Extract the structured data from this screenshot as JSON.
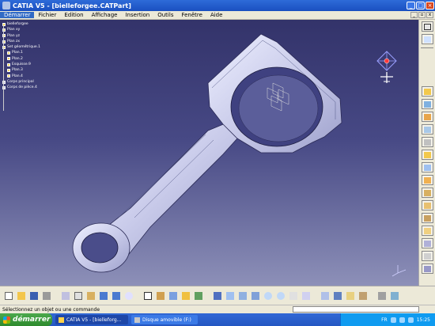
{
  "window": {
    "title": "CATIA V5 - [bielleforgee.CATPart]",
    "controls": [
      "_",
      "□",
      "×"
    ]
  },
  "menu": {
    "items": [
      "Démarrer",
      "Fichier",
      "Edition",
      "Affichage",
      "Insertion",
      "Outils",
      "Fenêtre",
      "Aide"
    ],
    "active": "Démarrer"
  },
  "tree": {
    "items": [
      {
        "label": "bielleforgee",
        "icon": "part-icon"
      },
      {
        "label": "Plan xy",
        "icon": "plane-icon"
      },
      {
        "label": "Plan yz",
        "icon": "plane-icon"
      },
      {
        "label": "Plan zx",
        "icon": "plane-icon"
      },
      {
        "label": "Set géométrique.1",
        "icon": "geometric-set-icon"
      },
      {
        "label": "Plan.1",
        "icon": "plane-icon"
      },
      {
        "label": "Plan.2",
        "icon": "plane-icon"
      },
      {
        "label": "Esquisse.9",
        "icon": "sketch-icon"
      },
      {
        "label": "Plan.3",
        "icon": "plane-icon"
      },
      {
        "label": "Plan.4",
        "icon": "plane-icon"
      },
      {
        "label": "Corps principal",
        "icon": "body-icon"
      },
      {
        "label": "Corps de pièce.4",
        "icon": "body-icon"
      }
    ]
  },
  "status": {
    "prompt": "Sélectionnez un objet ou une commande"
  },
  "taskbar": {
    "start_label": "démarrer",
    "tasks": [
      {
        "label": "CATIA V5 - [bielleforg...",
        "active": true
      },
      {
        "label": "Disque amovible (F:)",
        "active": false
      }
    ],
    "language": "FR",
    "clock": "15:25"
  },
  "colors": {
    "viewport_top": "#33336a",
    "viewport_bottom": "#8d90b8",
    "part_fill": "#d6d8f2",
    "titlebar": "#1a4fc0",
    "taskbar": "#2457c2",
    "start_button": "#3a9a3a"
  }
}
